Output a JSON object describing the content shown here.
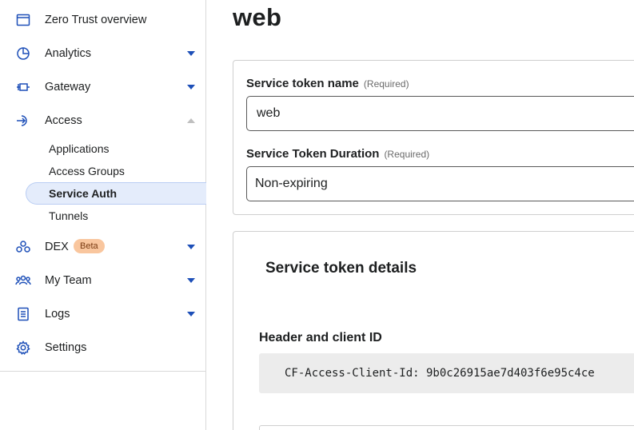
{
  "sidebar": {
    "items": [
      {
        "label": "Zero Trust overview",
        "icon": "browser-window-icon"
      },
      {
        "label": "Analytics",
        "icon": "pie-chart-icon"
      },
      {
        "label": "Gateway",
        "icon": "gateway-icon"
      },
      {
        "label": "Access",
        "icon": "access-icon"
      },
      {
        "label": "DEX",
        "icon": "dex-icon",
        "badge": "Beta"
      },
      {
        "label": "My Team",
        "icon": "team-icon"
      },
      {
        "label": "Logs",
        "icon": "logs-icon"
      },
      {
        "label": "Settings",
        "icon": "gear-icon"
      }
    ],
    "access_sub_items": [
      {
        "label": "Applications"
      },
      {
        "label": "Access Groups"
      },
      {
        "label": "Service Auth",
        "active": true
      },
      {
        "label": "Tunnels"
      }
    ]
  },
  "main": {
    "title": "web",
    "form": {
      "name_label": "Service token name",
      "name_required": "(Required)",
      "name_value": "web",
      "duration_label": "Service Token Duration",
      "duration_required": "(Required)",
      "duration_value": "Non-expiring"
    },
    "details": {
      "title": "Service token details",
      "header_label": "Header and client ID",
      "client_id_line": "CF-Access-Client-Id: 9b0c26915ae7d403f6e95c4ce"
    }
  },
  "colors": {
    "accent": "#1d4fb8",
    "active_bg": "#e4ecfb",
    "badge_bg": "#f9c69e",
    "code_bg": "#ececec"
  }
}
